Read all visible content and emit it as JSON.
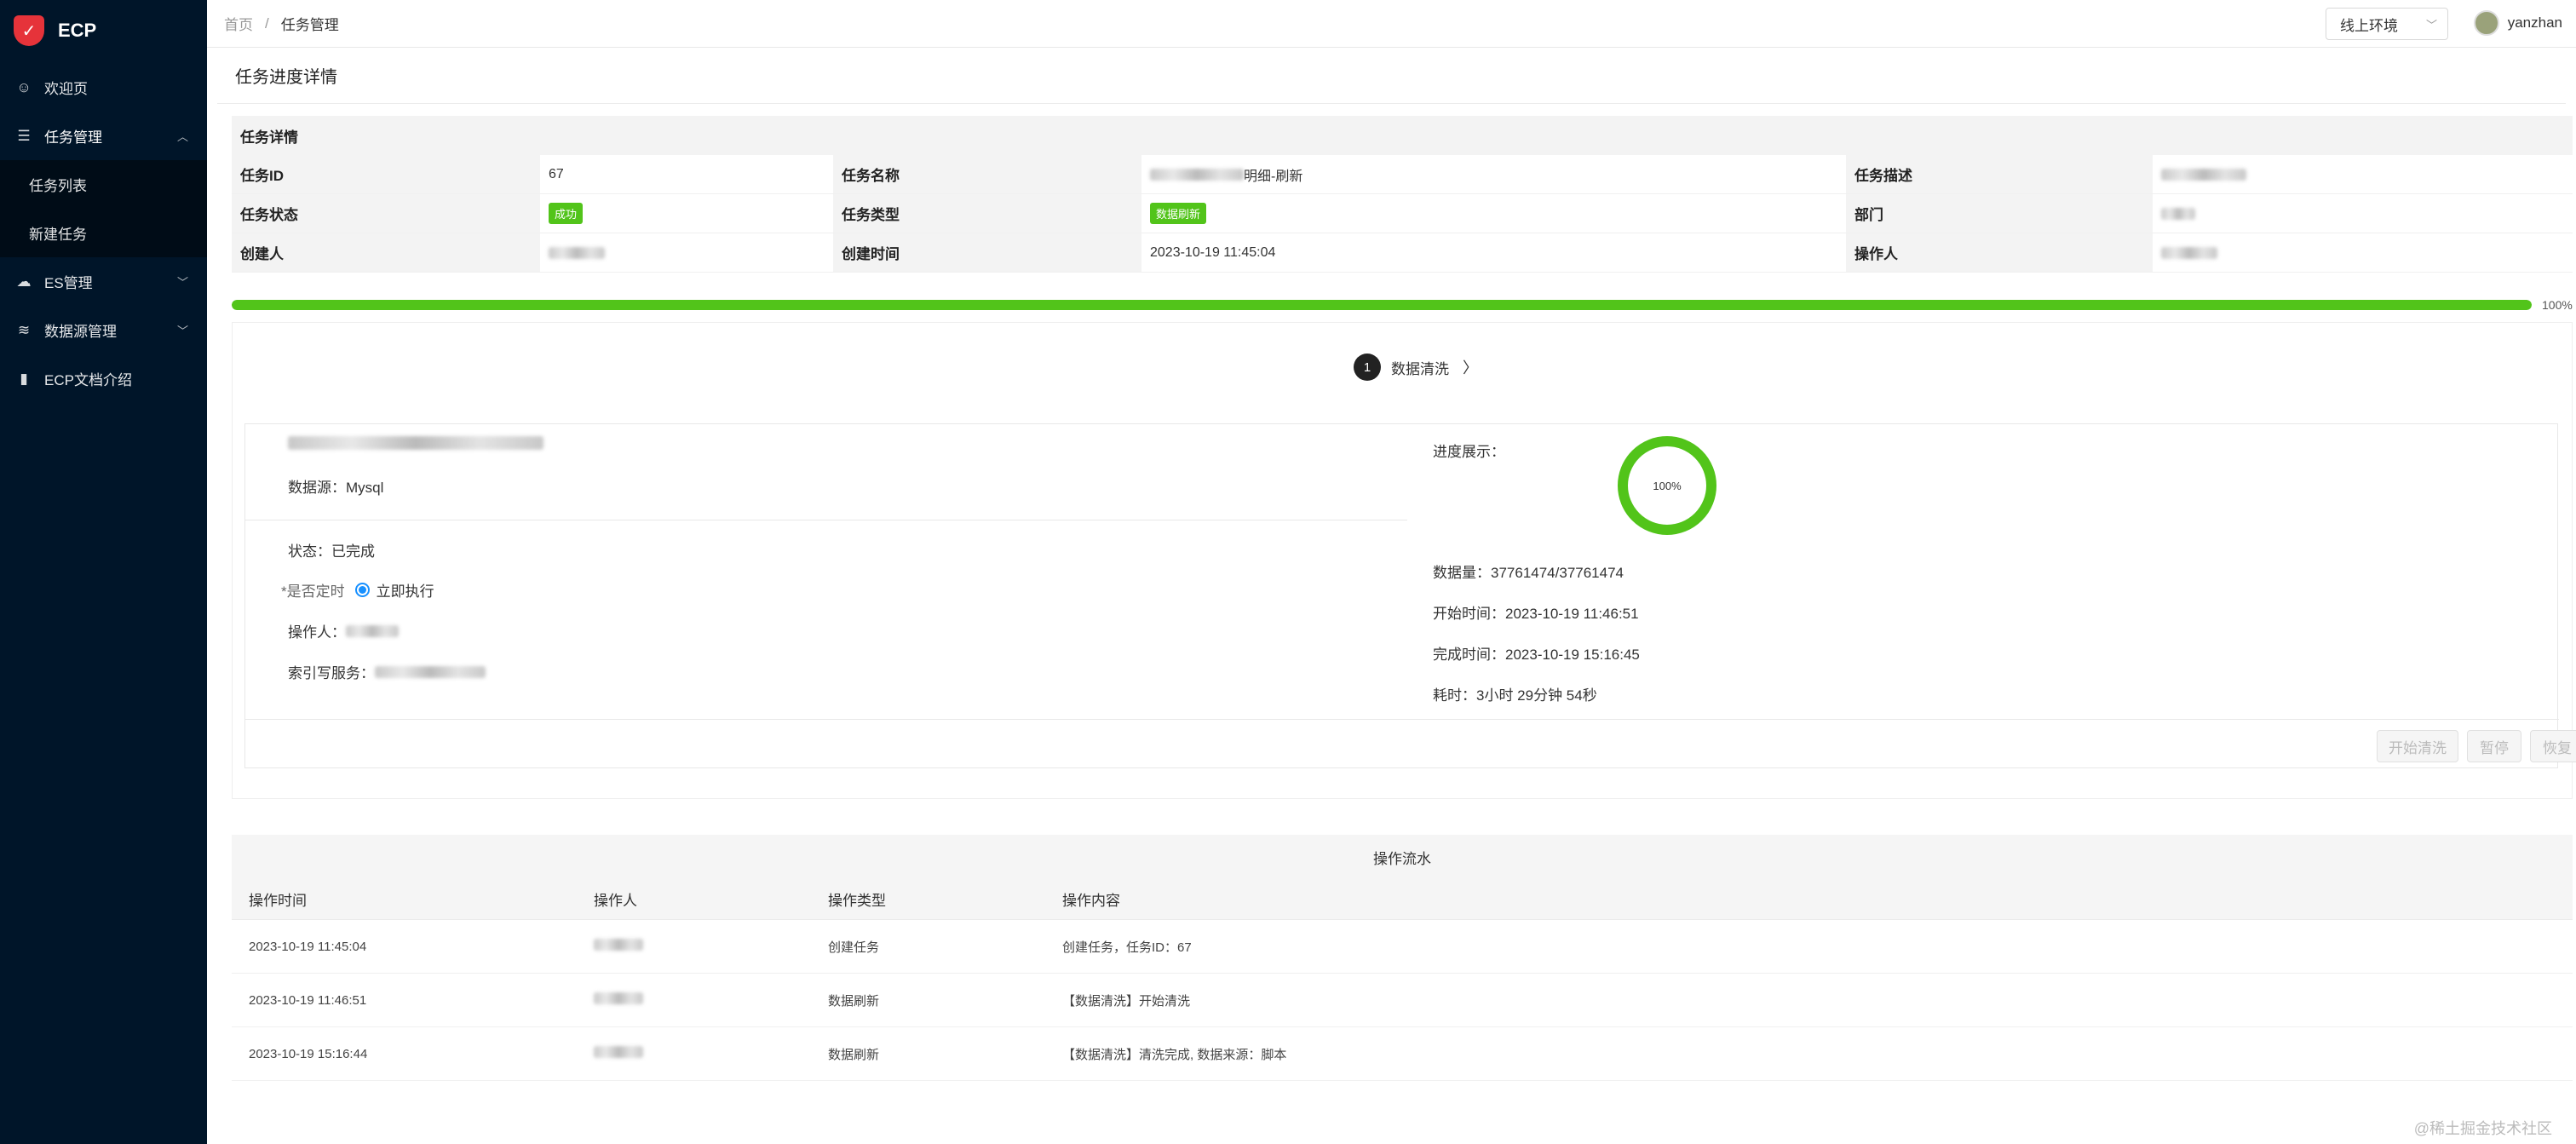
{
  "app": {
    "name": "ECP"
  },
  "sidebar": {
    "items": [
      {
        "label": "欢迎页",
        "icon": "smile-icon"
      },
      {
        "label": "任务管理",
        "icon": "list-icon",
        "expanded": true,
        "children": [
          {
            "label": "任务列表"
          },
          {
            "label": "新建任务"
          }
        ]
      },
      {
        "label": "ES管理",
        "icon": "cloud-icon"
      },
      {
        "label": "数据源管理",
        "icon": "database-icon"
      },
      {
        "label": "ECP文档介绍",
        "icon": "book-icon"
      }
    ]
  },
  "header": {
    "breadcrumb": {
      "home": "首页",
      "separator": "/",
      "current": "任务管理"
    },
    "env_select": "线上环境",
    "user": "yanzhan"
  },
  "page": {
    "title": "任务进度详情"
  },
  "details": {
    "title": "任务详情",
    "rows": [
      [
        {
          "label": "任务ID",
          "value": "67"
        },
        {
          "label": "任务名称",
          "value": "明细-刷新"
        },
        {
          "label": "任务描述",
          "value": ""
        }
      ],
      [
        {
          "label": "任务状态",
          "value": "成功"
        },
        {
          "label": "任务类型",
          "value": "数据刷新"
        },
        {
          "label": "部门",
          "value": ""
        }
      ],
      [
        {
          "label": "创建人",
          "value": ""
        },
        {
          "label": "创建时间",
          "value": "2023-10-19 11:45:04"
        },
        {
          "label": "操作人",
          "value": ""
        }
      ]
    ],
    "status_color": "#52c41a"
  },
  "progress": {
    "percent": 100,
    "label": "100%",
    "color": "#52c41a"
  },
  "steps": [
    {
      "number": "1",
      "label": "数据清洗"
    }
  ],
  "task_card": {
    "datasource": "数据源：Mysql",
    "status": "状态：已完成",
    "timer_label": "*是否定时",
    "timer_option": "立即执行",
    "operator_label": "操作人：",
    "index_service_label": "索引写服务：",
    "progress_label": "进度展示：",
    "ring_percent": 100,
    "ring_text": "100%",
    "data_volume": "数据量：37761474/37761474",
    "start_time": "开始时间：2023-10-19 11:46:51",
    "finish_time": "完成时间：2023-10-19 15:16:45",
    "duration": "耗时：3小时 29分钟 54秒",
    "buttons": {
      "start": "开始清洗",
      "pause": "暂停",
      "resume": "恢复"
    }
  },
  "log": {
    "title": "操作流水",
    "columns": [
      "操作时间",
      "操作人",
      "操作类型",
      "操作内容"
    ],
    "rows": [
      {
        "time": "2023-10-19 11:45:04",
        "type": "创建任务",
        "content": "创建任务，任务ID：67"
      },
      {
        "time": "2023-10-19 11:46:51",
        "type": "数据刷新",
        "content": "【数据清洗】开始清洗"
      },
      {
        "time": "2023-10-19 15:16:44",
        "type": "数据刷新",
        "content": "【数据清洗】清洗完成, 数据来源：脚本"
      }
    ]
  },
  "watermark": "@稀土掘金技术社区"
}
